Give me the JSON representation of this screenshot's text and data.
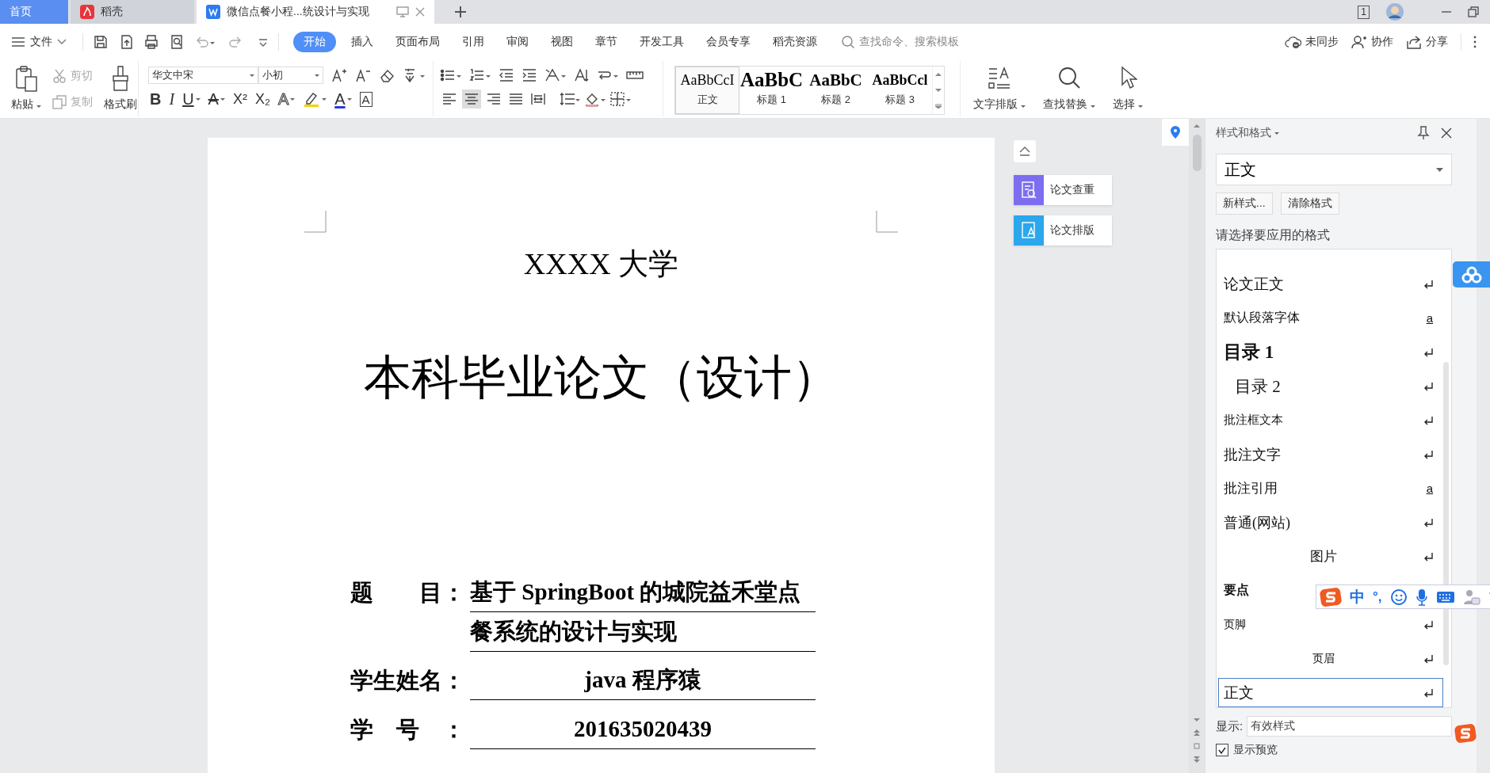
{
  "tabs": [
    {
      "label": "首页",
      "kind": "home",
      "selected": false
    },
    {
      "label": "稻壳",
      "kind": "docer",
      "selected": false
    },
    {
      "label": "微信点餐小程...统设计与实现",
      "kind": "doc",
      "selected": true
    }
  ],
  "window_count": "1",
  "menu": {
    "file": "文件",
    "tabs": [
      {
        "label": "开始",
        "selected": true
      },
      {
        "label": "插入",
        "selected": false
      },
      {
        "label": "页面布局",
        "selected": false
      },
      {
        "label": "引用",
        "selected": false
      },
      {
        "label": "审阅",
        "selected": false
      },
      {
        "label": "视图",
        "selected": false
      },
      {
        "label": "章节",
        "selected": false
      },
      {
        "label": "开发工具",
        "selected": false
      },
      {
        "label": "会员专享",
        "selected": false
      },
      {
        "label": "稻壳资源",
        "selected": false
      }
    ],
    "search_placeholder": "查找命令、搜索模板",
    "actions": [
      {
        "label": "未同步",
        "kind": "sync"
      },
      {
        "label": "协作",
        "kind": "collab"
      },
      {
        "label": "分享",
        "kind": "share"
      }
    ]
  },
  "ribbon": {
    "paste": "粘贴",
    "cut": {
      "label": "剪切",
      "disabled": true
    },
    "copy": {
      "label": "复制",
      "disabled": true
    },
    "format_painter": "格式刷",
    "font_name": "华文中宋",
    "font_size": "小初",
    "format_buttons": [
      {
        "kind": "bold",
        "glyph": "B"
      },
      {
        "kind": "italic",
        "glyph": "I"
      },
      {
        "kind": "underline",
        "glyph": "U"
      },
      {
        "kind": "strike",
        "glyph": "A"
      },
      {
        "kind": "superscript",
        "glyph": "X²"
      },
      {
        "kind": "subscript",
        "glyph": "X₂"
      },
      {
        "kind": "effect",
        "glyph": "A"
      },
      {
        "kind": "highlight"
      },
      {
        "kind": "color",
        "glyph": "A"
      },
      {
        "kind": "border",
        "glyph": "A"
      }
    ],
    "alignment": [
      {
        "kind": "left",
        "selected": false
      },
      {
        "kind": "center",
        "selected": true
      },
      {
        "kind": "right",
        "selected": false
      },
      {
        "kind": "justify",
        "selected": false
      },
      {
        "kind": "distributed",
        "selected": false
      }
    ],
    "styles": [
      {
        "preview": "AaBbCcI",
        "label": "正文",
        "kind": "body",
        "selected": true
      },
      {
        "preview": "AaBbC",
        "label": "标题 1",
        "kind": "heading1",
        "selected": false
      },
      {
        "preview": "AaBbC",
        "label": "标题 2",
        "kind": "heading2",
        "selected": false
      },
      {
        "preview": "AaBbCcl",
        "label": "标题 3",
        "kind": "heading3",
        "selected": false
      }
    ],
    "text_layout": "文字排版",
    "find_replace": "查找替换",
    "select": "选择"
  },
  "side_tools": [
    {
      "label": "论文查重",
      "kind": "check"
    },
    {
      "label": "论文排版",
      "kind": "layout"
    }
  ],
  "document": {
    "university": "XXXX 大学",
    "title": "本科毕业论文（设计）",
    "fields": [
      {
        "label": "题　　目：",
        "lines": [
          "基于 SpringBoot 的城院益禾堂点",
          "餐系统的设计与实现"
        ]
      },
      {
        "label": "学生姓名：",
        "lines": [
          "java 程序猿"
        ]
      },
      {
        "label": "学　号　：",
        "lines": [
          "201635020439"
        ]
      }
    ]
  },
  "styles_panel": {
    "title": "样式和格式",
    "current": "正文",
    "buttons": [
      "新样式...",
      "清除格式"
    ],
    "prompt": "请选择要应用的格式",
    "items": [
      {
        "label": "论文正文",
        "kind": "paragraph",
        "selected": false
      },
      {
        "label": "默认段落字体",
        "kind": "character",
        "marker": "a",
        "selected": false
      },
      {
        "label": "目录 1",
        "kind": "paragraph",
        "selected": false
      },
      {
        "label": "目录 2",
        "kind": "paragraph",
        "selected": false
      },
      {
        "label": "批注框文本",
        "kind": "paragraph",
        "selected": false
      },
      {
        "label": "批注文字",
        "kind": "paragraph",
        "selected": false
      },
      {
        "label": "批注引用",
        "kind": "character",
        "marker": "a",
        "selected": false
      },
      {
        "label": "普通(网站)",
        "kind": "paragraph",
        "selected": false
      },
      {
        "label": "图片",
        "kind": "paragraph",
        "selected": false
      },
      {
        "label": "要点",
        "selected": false
      },
      {
        "label": "页脚",
        "kind": "paragraph",
        "selected": false
      },
      {
        "label": "页眉",
        "kind": "paragraph",
        "selected": false
      },
      {
        "label": "正文",
        "kind": "paragraph",
        "selected": true
      }
    ],
    "show_label": "显示:",
    "show_value": "有效样式",
    "preview_label": "显示预览",
    "preview_checked": true
  },
  "ime": {
    "mode": "中",
    "punctuation": "°,"
  }
}
